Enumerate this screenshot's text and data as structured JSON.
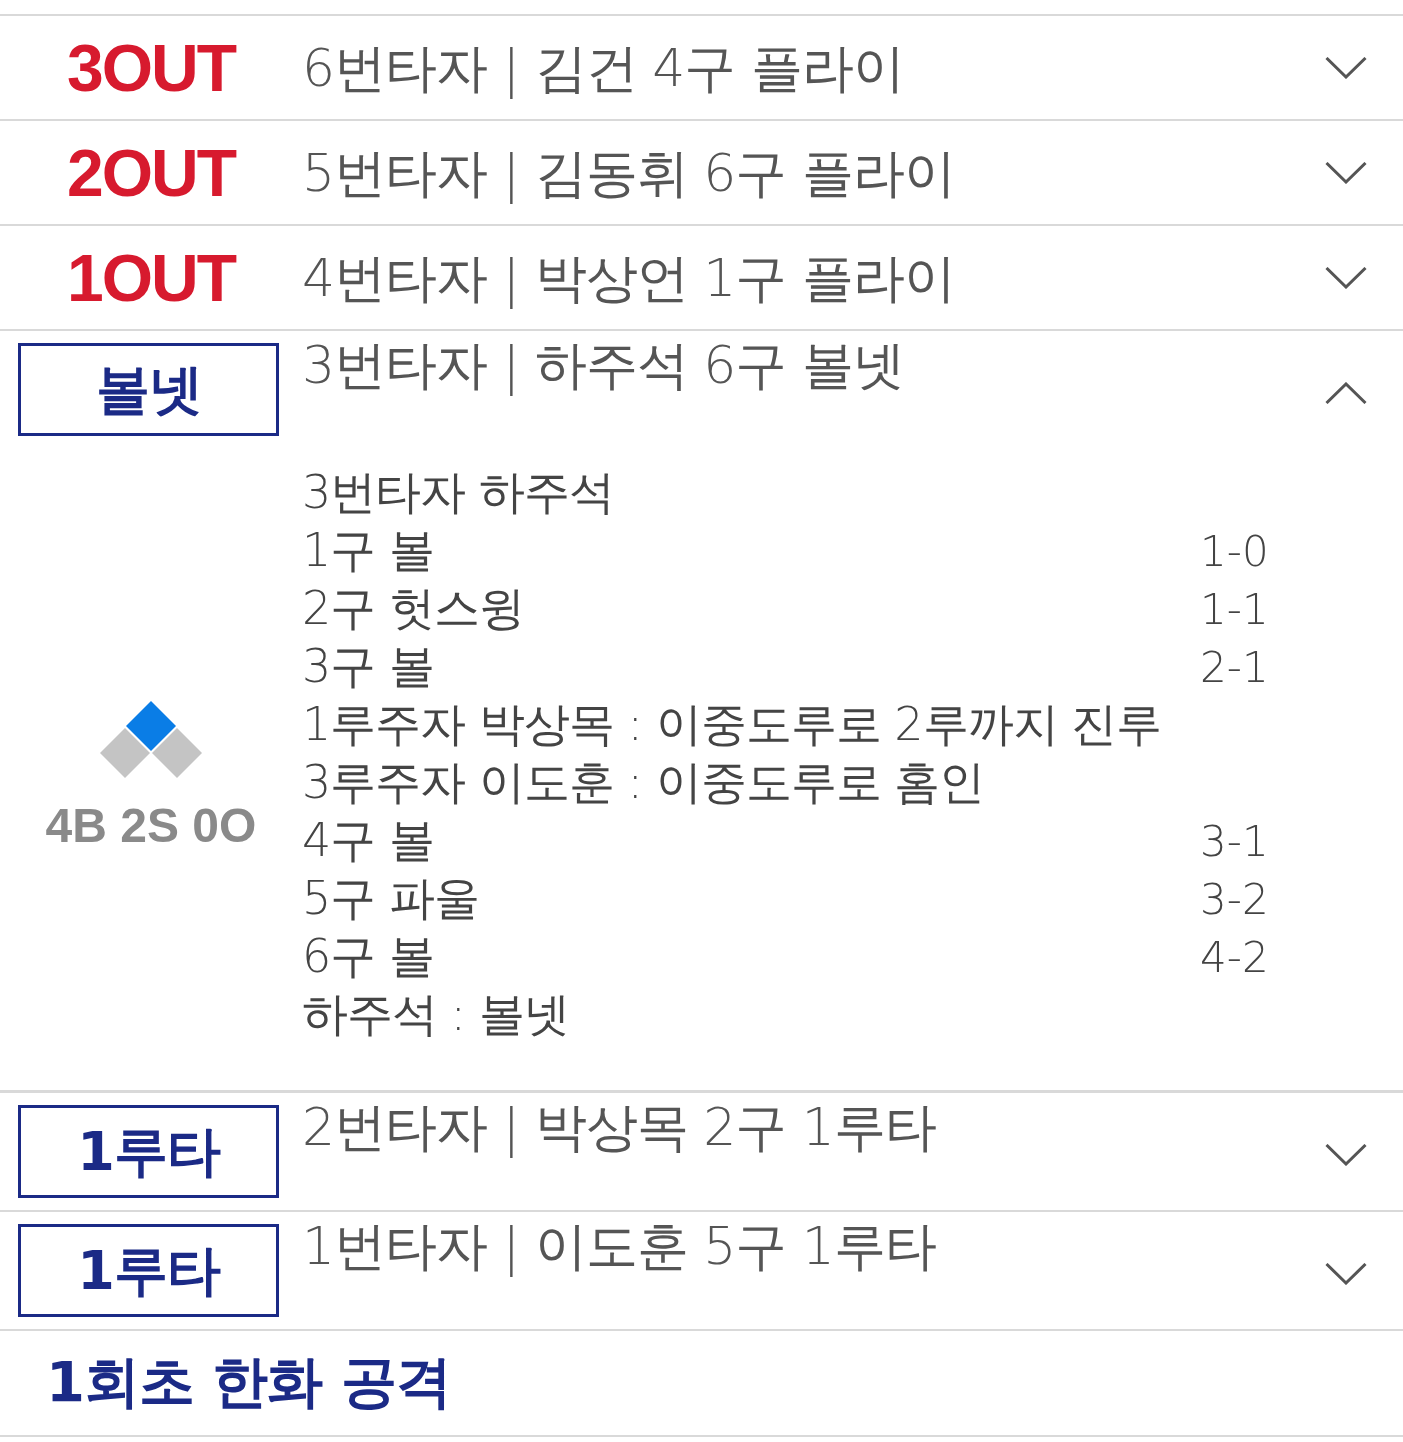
{
  "plays": [
    {
      "kind": "out",
      "label": "3OUT",
      "summary": "6번타자 | 김건 4구 플라이",
      "expanded": false
    },
    {
      "kind": "out",
      "label": "2OUT",
      "summary": "5번타자 | 김동휘 6구 플라이",
      "expanded": false
    },
    {
      "kind": "out",
      "label": "1OUT",
      "summary": "4번타자 | 박상언 1구 플라이",
      "expanded": false
    },
    {
      "kind": "result",
      "label": "볼넷",
      "summary": "3번타자 | 하주석 6구 볼넷",
      "expanded": true,
      "runners": {
        "first": false,
        "second": true,
        "third": false
      },
      "count": "4B 2S 0O",
      "details": [
        {
          "text": "3번타자 하주석"
        },
        {
          "text": "1구 볼",
          "count": "1-0"
        },
        {
          "text": "2구 헛스윙",
          "count": "1-1"
        },
        {
          "text": "3구 볼",
          "count": "2-1"
        },
        {
          "text": "1루주자 박상목 : 이중도루로 2루까지 진루"
        },
        {
          "text": "3루주자 이도훈 : 이중도루로 홈인"
        },
        {
          "text": "4구 볼",
          "count": "3-1"
        },
        {
          "text": "5구 파울",
          "count": "3-2"
        },
        {
          "text": "6구 볼",
          "count": "4-2"
        },
        {
          "text": "하주석 : 볼넷"
        }
      ]
    },
    {
      "kind": "result",
      "label": "1루타",
      "summary": "2번타자 | 박상목 2구 1루타",
      "expanded": false
    },
    {
      "kind": "result",
      "label": "1루타",
      "summary": "1번타자 | 이도훈 5구 1루타",
      "expanded": false
    }
  ],
  "inning_header": "1회초 한화 공격"
}
